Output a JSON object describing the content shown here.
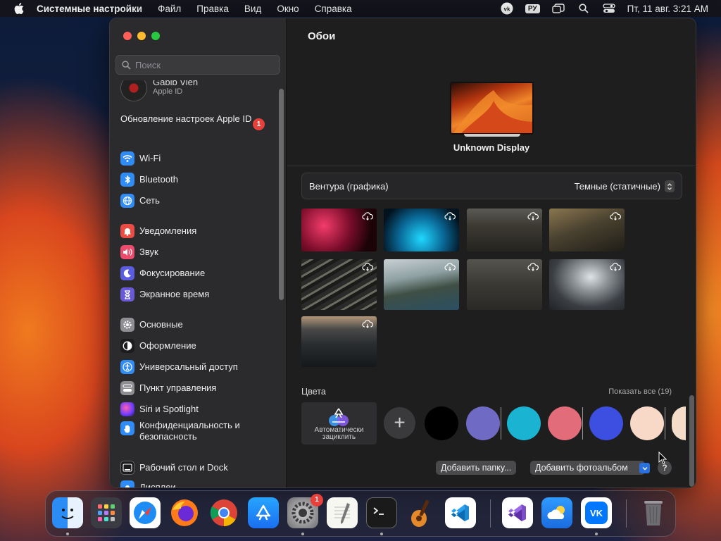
{
  "menubar": {
    "app_name": "Системные настройки",
    "items": [
      "Файл",
      "Правка",
      "Вид",
      "Окно",
      "Справка"
    ],
    "input_lang": "РУ",
    "clock": "Пт, 11 авг.  3:21 AM"
  },
  "sidebar": {
    "search_placeholder": "Поиск",
    "account": {
      "name": "Gabib Vien",
      "sub": "Apple ID"
    },
    "update": {
      "label": "Обновление настроек Apple ID",
      "badge": "1"
    },
    "items": [
      {
        "label": "Wi-Fi",
        "icon": "wifi-icon",
        "color": "#2f8cf6"
      },
      {
        "label": "Bluetooth",
        "icon": "bluetooth-icon",
        "color": "#2f8cf6"
      },
      {
        "label": "Сеть",
        "icon": "globe-icon",
        "color": "#2f8cf6"
      },
      {
        "label": "Уведомления",
        "icon": "bell-icon",
        "color": "#eb4c43"
      },
      {
        "label": "Звук",
        "icon": "speaker-icon",
        "color": "#eb4c6b"
      },
      {
        "label": "Фокусирование",
        "icon": "moon-icon",
        "color": "#5c5ce0"
      },
      {
        "label": "Экранное время",
        "icon": "hourglass-icon",
        "color": "#6a5ad8"
      },
      {
        "label": "Основные",
        "icon": "gear-icon",
        "color": "#8e8e93"
      },
      {
        "label": "Оформление",
        "icon": "appearance-icon",
        "color": "#1c1c1e"
      },
      {
        "label": "Универсальный доступ",
        "icon": "accessibility-icon",
        "color": "#2f8cf6"
      },
      {
        "label": "Пункт управления",
        "icon": "control-center-icon",
        "color": "#8e8e93"
      },
      {
        "label": "Siri и Spotlight",
        "icon": "siri-icon",
        "color": "#c23ad0"
      },
      {
        "label": "Конфиденциальность и безопасность",
        "icon": "hand-icon",
        "color": "#2f8cf6"
      },
      {
        "label": "Рабочий стол и Dock",
        "icon": "dock-icon",
        "color": "#1c1c1e"
      },
      {
        "label": "Дисплеи",
        "icon": "display-icon",
        "color": "#2f8cf6"
      }
    ]
  },
  "main": {
    "title": "Обои",
    "display_name": "Unknown Display",
    "wallpaper_name": "Вентура (графика)",
    "wallpaper_mode": "Темные (статичные)",
    "colors_label": "Цвета",
    "show_all": "Показать все (19)",
    "auto_rotate_label": "Автоматически зациклить",
    "add_folder": "Добавить папку...",
    "add_album": "Добавить фотоальбом",
    "help": "?",
    "swatches": [
      "#000000",
      "#6f6bc4",
      "#1ab4d2",
      "#e26c7a",
      "#3d4fe0",
      "#f8d8c6",
      "#f3dcc8"
    ]
  },
  "dock": {
    "apps": [
      "Finder",
      "Launchpad",
      "Safari",
      "Firefox",
      "Chrome",
      "App Store",
      "System Settings",
      "TextEdit",
      "Terminal",
      "GarageBand",
      "VS Code",
      "Visual Studio",
      "Weather",
      "VK",
      "Trash"
    ],
    "settings_badge": "1"
  }
}
